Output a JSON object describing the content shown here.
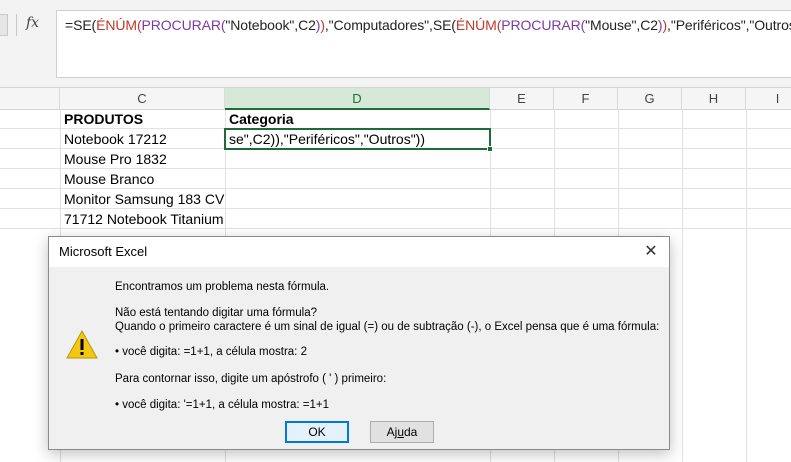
{
  "formula_bar": {
    "fx_label": "fx",
    "formula_segments": [
      {
        "text": "=SE(",
        "color": "black"
      },
      {
        "text": "ÉNÚM(",
        "color": "red"
      },
      {
        "text": "PROCURAR(",
        "color": "purple"
      },
      {
        "text": "\"Notebook\",C2",
        "color": "black"
      },
      {
        "text": ")",
        "color": "purple"
      },
      {
        "text": ")",
        "color": "red"
      },
      {
        "text": ",\"Computadores\",SE(",
        "color": "black"
      },
      {
        "text": "ÉNÚM(",
        "color": "red"
      },
      {
        "text": "PROCURAR(",
        "color": "purple"
      },
      {
        "text": "\"Mouse\",C2",
        "color": "black"
      },
      {
        "text": ")",
        "color": "purple"
      },
      {
        "text": ")",
        "color": "red"
      },
      {
        "text": ",\"Periféricos\",\"Outros\"",
        "color": "black"
      },
      {
        "text": "))",
        "color": "red"
      }
    ]
  },
  "columns": [
    "C",
    "D",
    "E",
    "F",
    "G",
    "H",
    "I"
  ],
  "active_column": "D",
  "cells": {
    "c1": "PRODUTOS",
    "d1": "Categoria",
    "c2": "Notebook 17212",
    "c3": "Mouse Pro 1832",
    "c4": "Mouse Branco",
    "c5": "Monitor Samsung 183 CV",
    "c6": "71712 Notebook Titanium"
  },
  "active_cell_text": "se\",C2)),\"Periféricos\",\"Outros\"))",
  "dialog": {
    "title": "Microsoft Excel",
    "close": "✕",
    "line1": "Encontramos um problema nesta fórmula.",
    "line2": "Não está tentando digitar uma fórmula?",
    "line3": "Quando o primeiro caractere é um sinal de igual (=) ou de subtração (-), o Excel pensa que é uma fórmula:",
    "line4": "• você digita:   =1+1, a célula mostra:   2",
    "line5": "Para contornar isso, digite um apóstrofo ( ' ) primeiro:",
    "line6": "• você digita:   '=1+1, a célula mostra:   =1+1",
    "ok_label": "OK",
    "help_label_prefix": "Aj",
    "help_label_underlined": "u",
    "help_label_suffix": "da"
  },
  "colors": {
    "excel_green": "#1e6b3a",
    "formula_red": "#c0392b",
    "formula_purple": "#7b3aa4",
    "warning_yellow": "#f2c811"
  }
}
